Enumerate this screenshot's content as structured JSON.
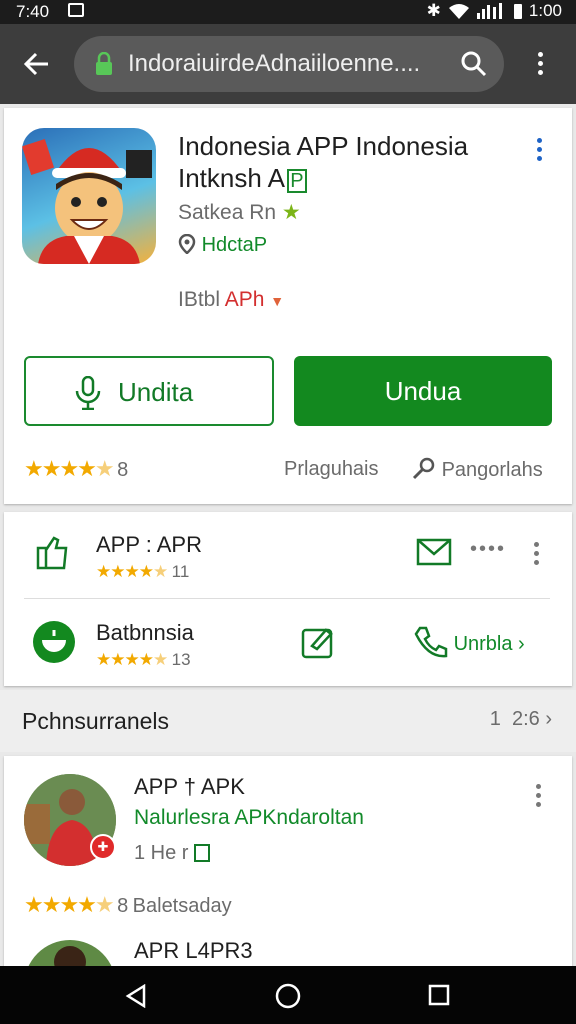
{
  "status_bar": {
    "time": "7:40",
    "right_time": "1:00"
  },
  "browser": {
    "url": "IndoraiuirdeAdnaiiloenne...."
  },
  "app": {
    "title_line1": "Indonesia APP Indonesia",
    "title_line2": "Intknsh A",
    "title_line2_badge": "P",
    "developer": "Satkea Rn",
    "location": "HdctaP",
    "version_label": "IBtbl",
    "version_value": "APh",
    "rating_count": "8",
    "link1": "Prlaguhais",
    "link2": "Pangorlahs"
  },
  "buttons": {
    "outline": "Undita",
    "primary": "Undua"
  },
  "related": [
    {
      "name": "APP : APR",
      "rating_text": "11"
    },
    {
      "name": "Batbnnsia",
      "rating_text": "13",
      "action": "Unrbla"
    }
  ],
  "section": {
    "title": "Pchnsurranels",
    "count": "1",
    "page": "2:6"
  },
  "review": {
    "title": "APP † APK",
    "subtitle": "Nalurlesra APKndaroltan",
    "meta": "1 He r",
    "rating_label": "8",
    "rating_text": "Baletsaday"
  },
  "next_item": {
    "title": "APR L4PR3"
  },
  "colors": {
    "green": "#13891f",
    "toolbar": "#3d3d3d",
    "star": "#f2a900"
  }
}
